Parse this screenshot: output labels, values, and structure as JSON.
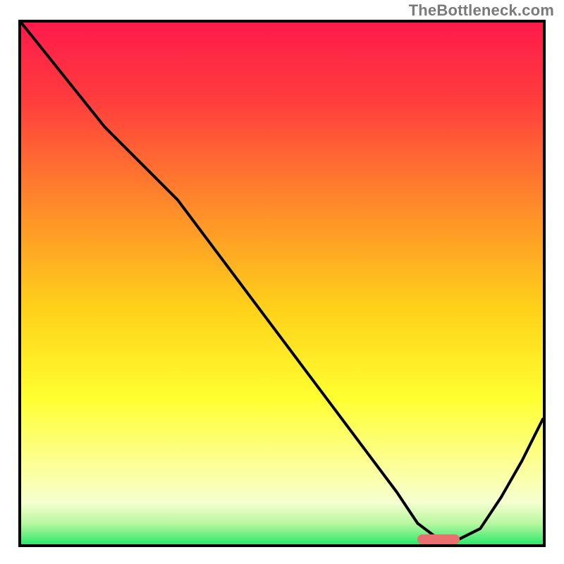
{
  "watermark": "TheBottleneck.com",
  "colors": {
    "frame": "#000000",
    "curve": "#000000",
    "marker": "#e8716f",
    "gradient_stops": [
      {
        "offset": 0.0,
        "color": "#ff1a4b"
      },
      {
        "offset": 0.15,
        "color": "#ff3d3d"
      },
      {
        "offset": 0.35,
        "color": "#ff8a2a"
      },
      {
        "offset": 0.55,
        "color": "#ffd21a"
      },
      {
        "offset": 0.72,
        "color": "#ffff30"
      },
      {
        "offset": 0.86,
        "color": "#fcffa0"
      },
      {
        "offset": 0.92,
        "color": "#f5ffd0"
      },
      {
        "offset": 0.96,
        "color": "#b8f7a0"
      },
      {
        "offset": 1.0,
        "color": "#2ee86b"
      }
    ]
  },
  "chart_data": {
    "type": "line",
    "title": "",
    "xlabel": "",
    "ylabel": "",
    "xlim": [
      0,
      100
    ],
    "ylim": [
      0,
      100
    ],
    "grid": false,
    "legend": false,
    "series": [
      {
        "name": "bottleneck-curve",
        "x": [
          0,
          8,
          16,
          24,
          30,
          36,
          42,
          48,
          54,
          60,
          66,
          72,
          76,
          80,
          84,
          88,
          92,
          96,
          100
        ],
        "y": [
          100,
          90,
          80,
          72,
          66,
          58,
          50,
          42,
          34,
          26,
          18,
          10,
          4,
          1,
          1,
          3,
          9,
          16,
          24
        ]
      }
    ],
    "annotations": [
      {
        "name": "optimal-marker",
        "x_start": 76,
        "x_end": 84,
        "y": 1
      }
    ]
  }
}
